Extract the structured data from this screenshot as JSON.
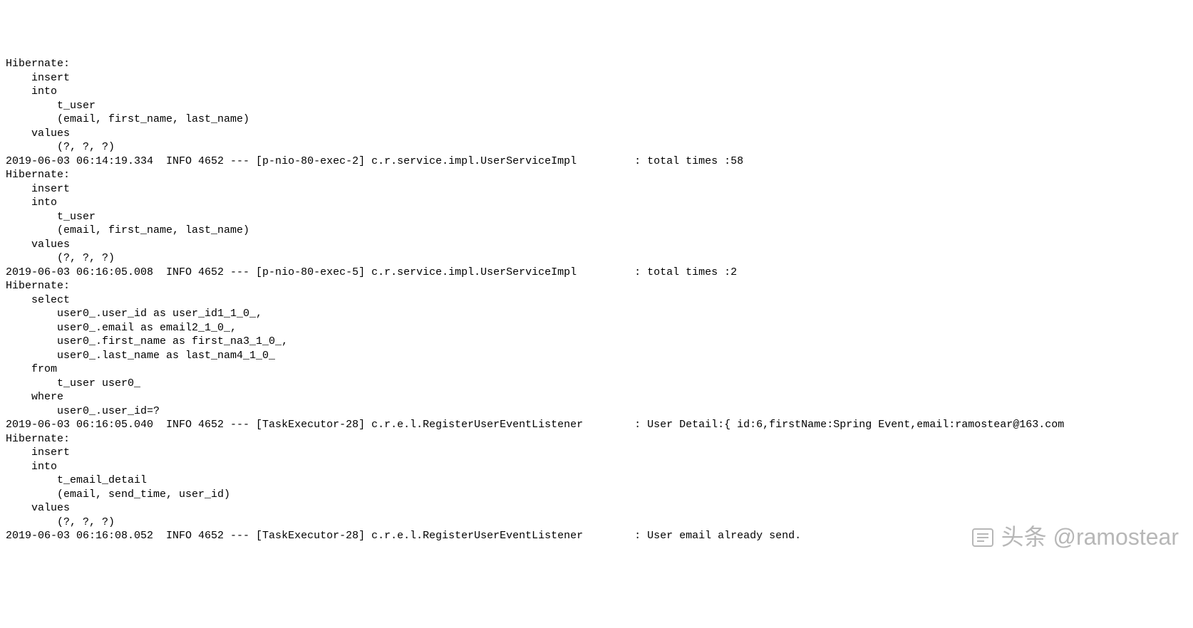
{
  "log_lines": [
    "Hibernate: ",
    "    insert ",
    "    into",
    "        t_user",
    "        (email, first_name, last_name) ",
    "    values",
    "        (?, ?, ?)",
    "2019-06-03 06:14:19.334  INFO 4652 --- [p-nio-80-exec-2] c.r.service.impl.UserServiceImpl         : total times :58",
    "Hibernate: ",
    "    insert ",
    "    into",
    "        t_user",
    "        (email, first_name, last_name) ",
    "    values",
    "        (?, ?, ?)",
    "2019-06-03 06:16:05.008  INFO 4652 --- [p-nio-80-exec-5] c.r.service.impl.UserServiceImpl         : total times :2",
    "Hibernate: ",
    "    select",
    "        user0_.user_id as user_id1_1_0_,",
    "        user0_.email as email2_1_0_,",
    "        user0_.first_name as first_na3_1_0_,",
    "        user0_.last_name as last_nam4_1_0_ ",
    "    from",
    "        t_user user0_ ",
    "    where",
    "        user0_.user_id=?",
    "2019-06-03 06:16:05.040  INFO 4652 --- [TaskExecutor-28] c.r.e.l.RegisterUserEventListener        : User Detail:{ id:6,firstName:Spring Event,email:ramostear@163.com",
    "Hibernate: ",
    "    insert ",
    "    into",
    "        t_email_detail",
    "        (email, send_time, user_id) ",
    "    values",
    "        (?, ?, ?)",
    "2019-06-03 06:16:08.052  INFO 4652 --- [TaskExecutor-28] c.r.e.l.RegisterUserEventListener        : User email already send."
  ],
  "watermark": {
    "text": "头条 @ramostear"
  }
}
